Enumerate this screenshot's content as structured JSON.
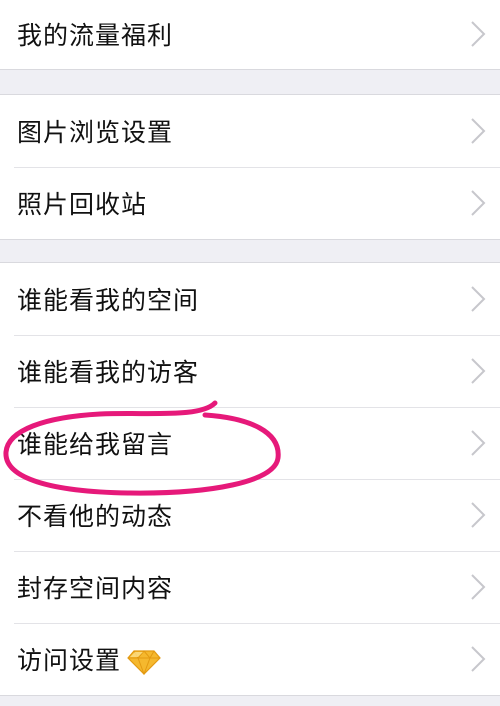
{
  "groups": [
    {
      "items": [
        {
          "label": "我的流量福利",
          "icon": "chevron-right-icon"
        }
      ]
    },
    {
      "items": [
        {
          "label": "图片浏览设置",
          "icon": "chevron-right-icon"
        },
        {
          "label": "照片回收站",
          "icon": "chevron-right-icon"
        }
      ]
    },
    {
      "items": [
        {
          "label": "谁能看我的空间",
          "icon": "chevron-right-icon"
        },
        {
          "label": "谁能看我的访客",
          "icon": "chevron-right-icon"
        },
        {
          "label": "谁能给我留言",
          "icon": "chevron-right-icon"
        },
        {
          "label": "不看他的动态",
          "icon": "chevron-right-icon"
        },
        {
          "label": "封存空间内容",
          "icon": "chevron-right-icon"
        },
        {
          "label": "访问设置",
          "icon": "chevron-right-icon",
          "badge_icon": "diamond-icon"
        }
      ]
    }
  ],
  "colors": {
    "background": "#efeff4",
    "row_background": "#ffffff",
    "text": "#111111",
    "chevron": "#c7c7cc",
    "annotation": "#e6197a",
    "diamond": "#f5b82e"
  }
}
